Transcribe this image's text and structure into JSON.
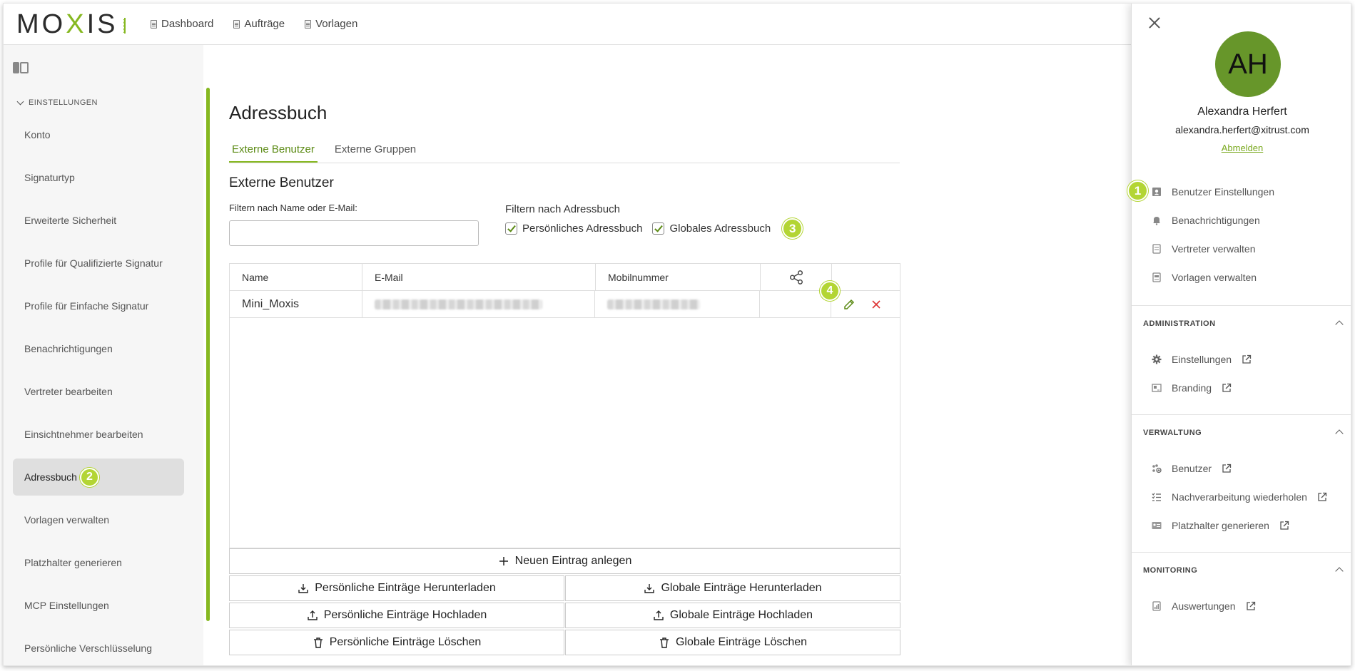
{
  "header": {
    "logo_text": "MOXIS",
    "nav": [
      {
        "label": "Dashboard",
        "icon": "dashboard-doc-icon"
      },
      {
        "label": "Aufträge",
        "icon": "orders-doc-icon"
      },
      {
        "label": "Vorlagen",
        "icon": "templates-doc-icon"
      }
    ]
  },
  "sidebar": {
    "section": "EINSTELLUNGEN",
    "items": [
      {
        "label": "Konto"
      },
      {
        "label": "Signaturtyp"
      },
      {
        "label": "Erweiterte Sicherheit"
      },
      {
        "label": "Profile für Qualifizierte Signatur"
      },
      {
        "label": "Profile für Einfache Signatur"
      },
      {
        "label": "Benachrichtigungen"
      },
      {
        "label": "Vertreter bearbeiten"
      },
      {
        "label": "Einsichtnehmer bearbeiten"
      },
      {
        "label": "Adressbuch",
        "active": true,
        "badge": "2"
      },
      {
        "label": "Vorlagen verwalten"
      },
      {
        "label": "Platzhalter generieren"
      },
      {
        "label": "MCP Einstellungen"
      },
      {
        "label": "Persönliche Verschlüsselung"
      }
    ]
  },
  "main": {
    "title": "Adressbuch",
    "tabs": [
      {
        "label": "Externe Benutzer",
        "active": true
      },
      {
        "label": "Externe Gruppen",
        "active": false
      }
    ],
    "subtitle": "Externe Benutzer",
    "filter_label": "Filtern nach Name oder E-Mail:",
    "filter_value": "",
    "addressbook_filter_label": "Filtern nach Adressbuch",
    "checkboxes": [
      {
        "label": "Persönliches Adressbuch",
        "checked": true
      },
      {
        "label": "Globales Adressbuch",
        "checked": true
      }
    ],
    "badge_filter": "3",
    "table": {
      "columns": [
        "Name",
        "E-Mail",
        "Mobilnummer"
      ],
      "share_icon": "share-icon",
      "rows": [
        {
          "name": "Mini_Moxis",
          "email": "(blurred)",
          "mobile": "(blurred)"
        }
      ],
      "badge_actions": "4"
    },
    "buttons": {
      "new_entry": "Neuen Eintrag anlegen",
      "download_personal": "Persönliche Einträge Herunterladen",
      "download_global": "Globale Einträge Herunterladen",
      "upload_personal": "Persönliche Einträge Hochladen",
      "upload_global": "Globale Einträge Hochladen",
      "delete_personal": "Persönliche Einträge Löschen",
      "delete_global": "Globale Einträge Löschen"
    }
  },
  "panel": {
    "avatar_initials": "AH",
    "user_name": "Alexandra Herfert",
    "user_email": "alexandra.herfert@xitrust.com",
    "logout_label": "Abmelden",
    "badge_user": "1",
    "user_items": [
      {
        "label": "Benutzer Einstellungen",
        "icon": "user-card-icon"
      },
      {
        "label": "Benachrichtigungen",
        "icon": "bell-icon"
      },
      {
        "label": "Vertreter verwalten",
        "icon": "doc-icon"
      },
      {
        "label": "Vorlagen verwalten",
        "icon": "template-icon"
      }
    ],
    "administration": {
      "head": "ADMINISTRATION",
      "items": [
        {
          "label": "Einstellungen",
          "icon": "gear-icon"
        },
        {
          "label": "Branding",
          "icon": "branding-icon"
        }
      ]
    },
    "verwaltung": {
      "head": "VERWALTUNG",
      "items": [
        {
          "label": "Benutzer",
          "icon": "users-icon"
        },
        {
          "label": "Nachverarbeitung wiederholen",
          "icon": "checklist-icon"
        },
        {
          "label": "Platzhalter generieren",
          "icon": "id-card-icon"
        }
      ]
    },
    "monitoring": {
      "head": "MONITORING",
      "items": [
        {
          "label": "Auswertungen",
          "icon": "report-icon"
        }
      ]
    }
  },
  "colors": {
    "accent": "#86b821",
    "accent_dark": "#5b8a14",
    "badge": "#b3d534",
    "avatar": "#67962a",
    "delete": "#d33"
  }
}
